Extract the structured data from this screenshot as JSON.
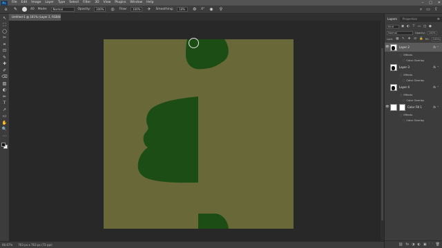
{
  "app": {
    "logo": "Ps"
  },
  "menubar": {
    "items": [
      "File",
      "Edit",
      "Image",
      "Layer",
      "Type",
      "Select",
      "Filter",
      "3D",
      "View",
      "Plugins",
      "Window",
      "Help"
    ],
    "window_controls": {
      "minimize": "–",
      "maximize": "□",
      "close": "✕"
    }
  },
  "options": {
    "brush_size": "40",
    "mode_label": "Mode:",
    "mode_value": "Normal",
    "opacity_label": "Opacity:",
    "opacity_value": "100%",
    "flow_label": "Flow:",
    "flow_value": "100%",
    "smoothing_label": "Smoothing:",
    "smoothing_value": "10%",
    "angle_value": "0°"
  },
  "document": {
    "tab_title": "Untitled-1 @ 161% (Layer 2, RGB/8#) *",
    "zoom": "66.67%",
    "doc_info": "763 px x 763 px (72 ppi)"
  },
  "tools": [
    "↖",
    "⬚",
    "◯",
    "✂",
    "⌗",
    "⊡",
    "✎",
    "✚",
    "✐",
    "⌫",
    "▨",
    "◐",
    "✏",
    "T",
    "↗",
    "▭",
    "✋",
    "🔍",
    "⋯"
  ],
  "colors": {
    "canvas_bg": "#686838",
    "shape_fill": "#1b4d14",
    "foreground": "#111111",
    "background": "#ffffff"
  },
  "layers_panel": {
    "tabs": [
      "Layers",
      "Properties"
    ],
    "menu": "≡",
    "filter_kind": "Kind",
    "blend_mode": "Normal",
    "opacity_label": "Opacity:",
    "opacity_value": "100%",
    "lock_label": "Lock:",
    "fill_label": "Fill:",
    "fill_value": "100%",
    "layers": [
      {
        "name": "Layer 2",
        "visible": true,
        "fx": "fx",
        "effects_label": "Effects",
        "effect": "Color Overlay"
      },
      {
        "name": "Layer 3",
        "visible": false,
        "fx": "fx",
        "effects_label": "Effects",
        "effect": "Color Overlay"
      },
      {
        "name": "Layer 4",
        "visible": false,
        "fx": "fx",
        "effects_label": "Effects",
        "effect": "Color Overlay"
      },
      {
        "name": "Color Fill 1",
        "visible": true,
        "fx": "fx",
        "effects_label": "Effects",
        "effect": "Color Overlay"
      }
    ],
    "footer_icons": [
      "⛓",
      "fx",
      "◑",
      "◐",
      "▣",
      "🗀",
      "🗑"
    ]
  }
}
